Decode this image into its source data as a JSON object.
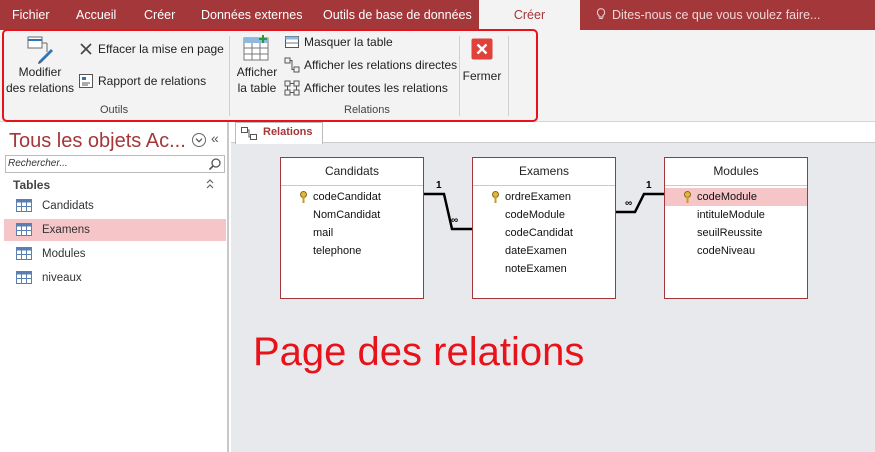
{
  "ribbon_tabs": [
    "Fichier",
    "Accueil",
    "Créer",
    "Données externes",
    "Outils de base de données",
    "Créer"
  ],
  "active_tab_index": 5,
  "tell_me": "Dites-nous ce que vous voulez faire...",
  "ribbon": {
    "outils": {
      "label": "Outils",
      "modifier_line1": "Modifier",
      "modifier_line2": "des relations",
      "effacer": "Effacer la mise en page",
      "rapport": "Rapport de relations"
    },
    "relations": {
      "label": "Relations",
      "afficher_line1": "Afficher",
      "afficher_line2": "la table",
      "masquer": "Masquer la table",
      "directes": "Afficher les relations directes",
      "toutes": "Afficher toutes les relations"
    },
    "fermer": "Fermer"
  },
  "nav": {
    "title": "Tous les objets Ac...",
    "collapse": "«",
    "search_placeholder": "Rechercher...",
    "section_title": "Tables",
    "items": [
      "Candidats",
      "Examens",
      "Modules",
      "niveaux"
    ],
    "selected_index": 1
  },
  "document_tab": "Relations",
  "tables": [
    {
      "name": "Candidats",
      "fields": [
        "codeCandidat",
        "NomCandidat",
        "mail",
        "telephone"
      ],
      "key_field": 0
    },
    {
      "name": "Examens",
      "fields": [
        "ordreExamen",
        "codeModule",
        "codeCandidat",
        "dateExamen",
        "noteExamen"
      ],
      "key_field": 0
    },
    {
      "name": "Modules",
      "fields": [
        "codeModule",
        "intituleModule",
        "seuilReussite",
        "codeNiveau"
      ],
      "key_field": 0,
      "highlighted_field": 0
    }
  ],
  "relationship_labels": {
    "one": "1",
    "many": "∞"
  },
  "annotation": "Page des relations",
  "colors": {
    "accent": "#a4373a",
    "annotation": "#e8131a",
    "selection": "#f6c5c8"
  }
}
